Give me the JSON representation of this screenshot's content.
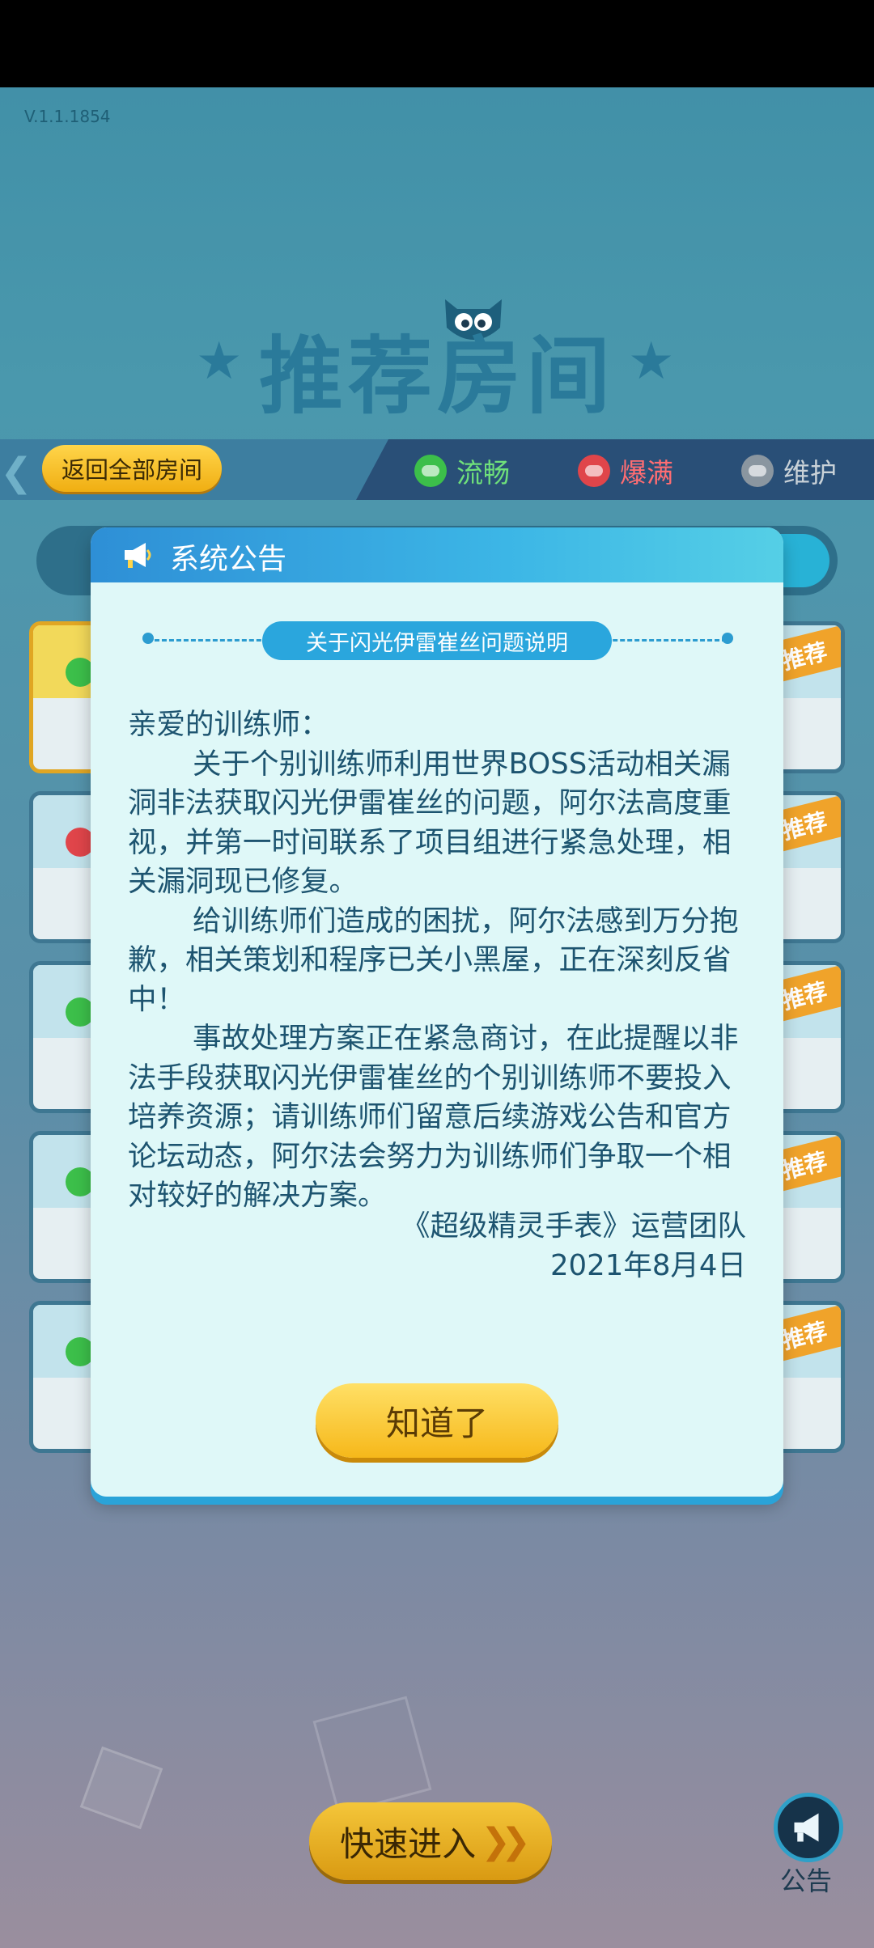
{
  "version": "V.1.1.1854",
  "page_title": "推荐房间",
  "filter_bar": {
    "back_label": "返回全部房间",
    "legend": [
      {
        "label": "流畅",
        "color": "#3cbf4a"
      },
      {
        "label": "爆满",
        "color": "#e0454a"
      },
      {
        "label": "维护",
        "color": "#8a96a0"
      }
    ]
  },
  "room_tag": "推荐",
  "modal": {
    "title": "系统公告",
    "subtitle": "关于闪光伊雷崔丝问题说明",
    "greeting": "亲爱的训练师：",
    "paragraphs": [
      "关于个别训练师利用世界BOSS活动相关漏洞非法获取闪光伊雷崔丝的问题，阿尔法高度重视，并第一时间联系了项目组进行紧急处理，相关漏洞现已修复。",
      "给训练师们造成的困扰，阿尔法感到万分抱歉，相关策划和程序已关小黑屋，正在深刻反省中！",
      "事故处理方案正在紧急商讨，在此提醒以非法手段获取闪光伊雷崔丝的个别训练师不要投入培养资源；请训练师们留意后续游戏公告和官方论坛动态，阿尔法会努力为训练师们争取一个相对较好的解决方案。"
    ],
    "signature": "《超级精灵手表》运营团队",
    "date": "2021年8月4日",
    "ok_label": "知道了"
  },
  "quick_enter_label": "快速进入",
  "notice_label": "公告"
}
